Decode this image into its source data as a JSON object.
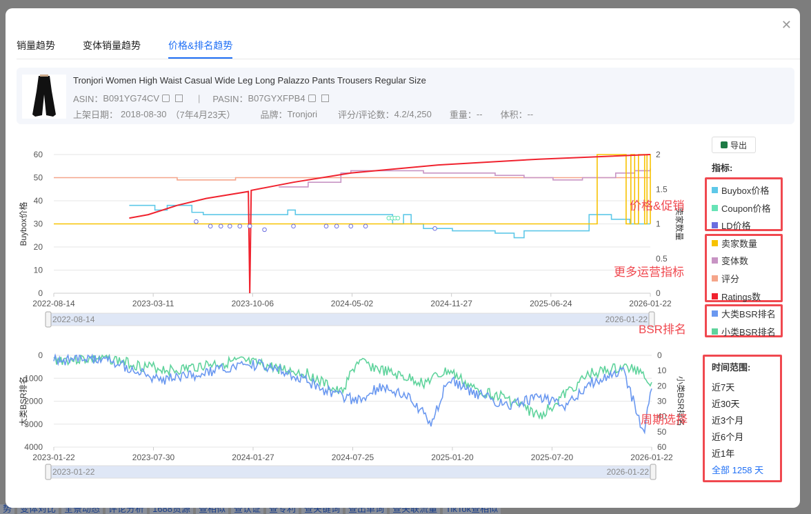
{
  "background": {
    "bottom_tabs": [
      "势",
      "变体对比",
      "全景动态",
      "评论分析",
      "1688货源",
      "查相似",
      "查认证",
      "查专利",
      "查关键词",
      "查出单词",
      "查关联流量",
      "TikTok查相似"
    ]
  },
  "modal": {
    "close_icon": "close-icon",
    "tabs": [
      {
        "label": "销量趋势"
      },
      {
        "label": "变体销量趋势"
      },
      {
        "label": "价格&排名趋势",
        "active": true
      }
    ],
    "product": {
      "title": "Tronjori Women High Waist Casual Wide Leg Long Palazzo Pants Trousers Regular Size",
      "asin_label": "ASIN：",
      "asin": "B091YG74CV",
      "sep": "|",
      "pasin_label": "PASIN：",
      "pasin": "B07GYXFPB4",
      "date_label": "上架日期：",
      "date": "2018-08-30",
      "age": "（7年4月23天）",
      "brand_label": "品牌：",
      "brand": "Tronjori",
      "rating_label": "评分/评论数：",
      "rating": "4.2/4,250",
      "weight_label": "重量：",
      "weight": "--",
      "volume_label": "体积：",
      "volume": "--"
    },
    "export_label": "导出",
    "indicators_title": "指标:",
    "legend": [
      {
        "label": "Buybox价格",
        "color": "#5ec8e8"
      },
      {
        "label": "Coupon价格",
        "color": "#67e3b6"
      },
      {
        "label": "LD价格",
        "color": "#6b6ee0"
      },
      {
        "label": "卖家数量",
        "color": "#f7c200"
      },
      {
        "label": "变体数",
        "color": "#c894c4"
      },
      {
        "label": "评分",
        "color": "#f5a58a"
      },
      {
        "label": "Ratings数",
        "color": "#f0222e"
      },
      {
        "label": "大类BSR排名",
        "color": "#6a98f0"
      },
      {
        "label": "小类BSR排名",
        "color": "#5fd39c"
      }
    ],
    "annotations": [
      "价格&促销",
      "更多运营指标",
      "BSR排名",
      "周期选择"
    ],
    "time_range": {
      "title": "时间范围:",
      "options": [
        "近7天",
        "近30天",
        "近3个月",
        "近6个月",
        "近1年",
        "全部 1258 天"
      ],
      "selected": 5
    }
  },
  "chart_data": [
    {
      "type": "line",
      "title": "价格&运营指标",
      "ylabel": "Buybox价格",
      "y2label": "卖家数量",
      "ylim": [
        0,
        60
      ],
      "y2lim": [
        0,
        2
      ],
      "yticks": [
        "0",
        "10",
        "20",
        "30",
        "40",
        "50",
        "60"
      ],
      "y2ticks": [
        "0",
        "0.5",
        "1",
        "1.5",
        "2"
      ],
      "xlim": [
        "2022-08-14",
        "2026-01-22"
      ],
      "xticks": [
        "2022-08-14",
        "2023-03-11",
        "2023-10-06",
        "2024-05-02",
        "2024-11-27",
        "2025-06-24",
        "2026-01-22"
      ],
      "slider": {
        "start": "2022-08-14",
        "end": "2026-01-22"
      },
      "series": [
        {
          "name": "评分",
          "axis": "left",
          "step": true,
          "points": [
            [
              "2022-08-14",
              50
            ],
            [
              "2023-05-01",
              49
            ],
            [
              "2023-09-01",
              50
            ],
            [
              "2026-01-22",
              50
            ]
          ]
        },
        {
          "name": "变体数",
          "axis": "left",
          "step": true,
          "points": [
            [
              "2023-12-01",
              46
            ],
            [
              "2024-02-01",
              48
            ],
            [
              "2024-04-10",
              52
            ],
            [
              "2024-05-01",
              53
            ],
            [
              "2024-10-01",
              52
            ],
            [
              "2025-03-01",
              51
            ],
            [
              "2025-05-01",
              50
            ],
            [
              "2025-07-01",
              49
            ],
            [
              "2025-09-01",
              50
            ],
            [
              "2025-11-10",
              52
            ],
            [
              "2025-12-20",
              53
            ],
            [
              "2026-01-22",
              54
            ]
          ]
        },
        {
          "name": "Buybox价格",
          "axis": "left",
          "step": true,
          "points": [
            [
              "2023-01-20",
              38
            ],
            [
              "2023-03-15",
              36
            ],
            [
              "2023-04-10",
              38
            ],
            [
              "2023-06-01",
              35
            ],
            [
              "2023-06-25",
              34
            ],
            [
              "2023-08-01",
              34
            ],
            [
              "2023-12-20",
              36
            ],
            [
              "2024-01-05",
              34
            ],
            [
              "2024-07-20",
              34
            ],
            [
              "2024-07-28",
              30
            ],
            [
              "2024-08-20",
              34
            ],
            [
              "2024-09-05",
              30
            ],
            [
              "2024-10-01",
              28
            ],
            [
              "2024-12-01",
              27
            ],
            [
              "2025-03-01",
              26
            ],
            [
              "2025-04-10",
              24
            ],
            [
              "2025-05-01",
              27
            ],
            [
              "2025-08-10",
              27
            ],
            [
              "2025-09-15",
              34
            ],
            [
              "2025-11-01",
              32
            ],
            [
              "2025-12-10",
              30
            ],
            [
              "2026-01-22",
              30
            ]
          ]
        },
        {
          "name": "卖家数量",
          "axis": "right",
          "step": true,
          "points": [
            [
              "2022-08-14",
              1
            ],
            [
              "2025-10-01",
              1
            ],
            [
              "2025-10-02",
              2
            ],
            [
              "2025-12-01",
              2
            ],
            [
              "2025-12-02",
              1
            ],
            [
              "2025-12-12",
              2
            ],
            [
              "2025-12-20",
              1
            ],
            [
              "2025-12-28",
              2
            ],
            [
              "2026-01-10",
              1
            ],
            [
              "2026-01-15",
              2
            ],
            [
              "2026-01-22",
              1
            ]
          ]
        },
        {
          "name": "Ratings数",
          "axis": "left",
          "step": false,
          "points": [
            [
              "2023-01-20",
              32.5
            ],
            [
              "2023-03-01",
              34
            ],
            [
              "2023-05-01",
              38
            ],
            [
              "2023-07-01",
              41
            ],
            [
              "2023-09-28",
              44
            ],
            [
              "2023-10-01",
              0
            ],
            [
              "2023-10-04",
              44.5
            ],
            [
              "2024-01-01",
              48
            ],
            [
              "2024-05-01",
              52
            ],
            [
              "2024-11-01",
              55.5
            ],
            [
              "2025-06-01",
              58
            ],
            [
              "2026-01-22",
              60
            ]
          ]
        },
        {
          "name": "LD价格",
          "axis": "left",
          "markers": "circle",
          "points": [
            [
              "2023-06-10",
              31
            ],
            [
              "2023-07-10",
              29
            ],
            [
              "2023-08-01",
              29
            ],
            [
              "2023-08-20",
              29
            ],
            [
              "2023-09-10",
              29
            ],
            [
              "2023-10-01",
              29
            ],
            [
              "2023-11-01",
              27.5
            ],
            [
              "2024-01-01",
              29
            ],
            [
              "2024-03-10",
              29
            ],
            [
              "2024-04-01",
              29
            ],
            [
              "2024-05-01",
              29
            ],
            [
              "2024-06-01",
              29
            ],
            [
              "2024-10-25",
              28
            ]
          ]
        },
        {
          "name": "Coupon价格",
          "axis": "left",
          "markers": "circle",
          "points": [
            [
              "2024-07-20",
              32.5
            ],
            [
              "2024-07-27",
              32.5
            ],
            [
              "2024-08-02",
              32.5
            ],
            [
              "2024-08-08",
              32.5
            ]
          ]
        }
      ]
    },
    {
      "type": "line",
      "ylabel": "大类BSR排名",
      "y2label": "小类BSR排名",
      "ylim": [
        0,
        4000
      ],
      "y2lim": [
        0,
        60
      ],
      "inverted": true,
      "yticks": [
        "0",
        "1000",
        "2000",
        "3000",
        "4000"
      ],
      "y2ticks": [
        "0",
        "10",
        "20",
        "30",
        "40",
        "50",
        "60"
      ],
      "xlim": [
        "2023-01-22",
        "2026-01-22"
      ],
      "xticks": [
        "2023-01-22",
        "2023-07-30",
        "2024-01-27",
        "2024-07-25",
        "2025-01-20",
        "2025-07-20",
        "2026-01-22"
      ],
      "slider": {
        "start": "2023-01-22",
        "end": "2026-01-22"
      },
      "series": [
        {
          "name": "小类BSR排名",
          "axis": "right",
          "points": [
            [
              "2023-01-22",
              3
            ],
            [
              "2023-05-01",
              2
            ],
            [
              "2023-07-01",
              7
            ],
            [
              "2023-09-01",
              10
            ],
            [
              "2023-11-01",
              6
            ],
            [
              "2024-01-01",
              4
            ],
            [
              "2024-03-01",
              8
            ],
            [
              "2024-05-01",
              12
            ],
            [
              "2024-07-01",
              25
            ],
            [
              "2024-08-01",
              4
            ],
            [
              "2024-10-01",
              12
            ],
            [
              "2024-12-01",
              18
            ],
            [
              "2025-01-15",
              10
            ],
            [
              "2025-03-01",
              22
            ],
            [
              "2025-05-01",
              28
            ],
            [
              "2025-07-01",
              40
            ],
            [
              "2025-08-01",
              30
            ],
            [
              "2025-10-01",
              12
            ],
            [
              "2025-12-01",
              8
            ],
            [
              "2026-01-05",
              10
            ],
            [
              "2026-01-22",
              20
            ]
          ]
        },
        {
          "name": "大类BSR排名",
          "axis": "left",
          "points": [
            [
              "2023-01-22",
              200
            ],
            [
              "2023-05-01",
              150
            ],
            [
              "2023-06-15",
              600
            ],
            [
              "2023-08-01",
              1100
            ],
            [
              "2023-10-01",
              900
            ],
            [
              "2023-12-01",
              600
            ],
            [
              "2024-02-01",
              400
            ],
            [
              "2024-04-01",
              800
            ],
            [
              "2024-06-01",
              1500
            ],
            [
              "2024-08-01",
              2000
            ],
            [
              "2024-09-15",
              1300
            ],
            [
              "2024-11-01",
              1800
            ],
            [
              "2024-12-15",
              2900
            ],
            [
              "2025-01-15",
              1000
            ],
            [
              "2025-03-01",
              1600
            ],
            [
              "2025-05-01",
              2200
            ],
            [
              "2025-07-01",
              1800
            ],
            [
              "2025-08-15",
              2300
            ],
            [
              "2025-10-01",
              1200
            ],
            [
              "2025-12-01",
              700
            ],
            [
              "2026-01-08",
              3400
            ],
            [
              "2026-01-22",
              1300
            ]
          ]
        }
      ]
    }
  ]
}
